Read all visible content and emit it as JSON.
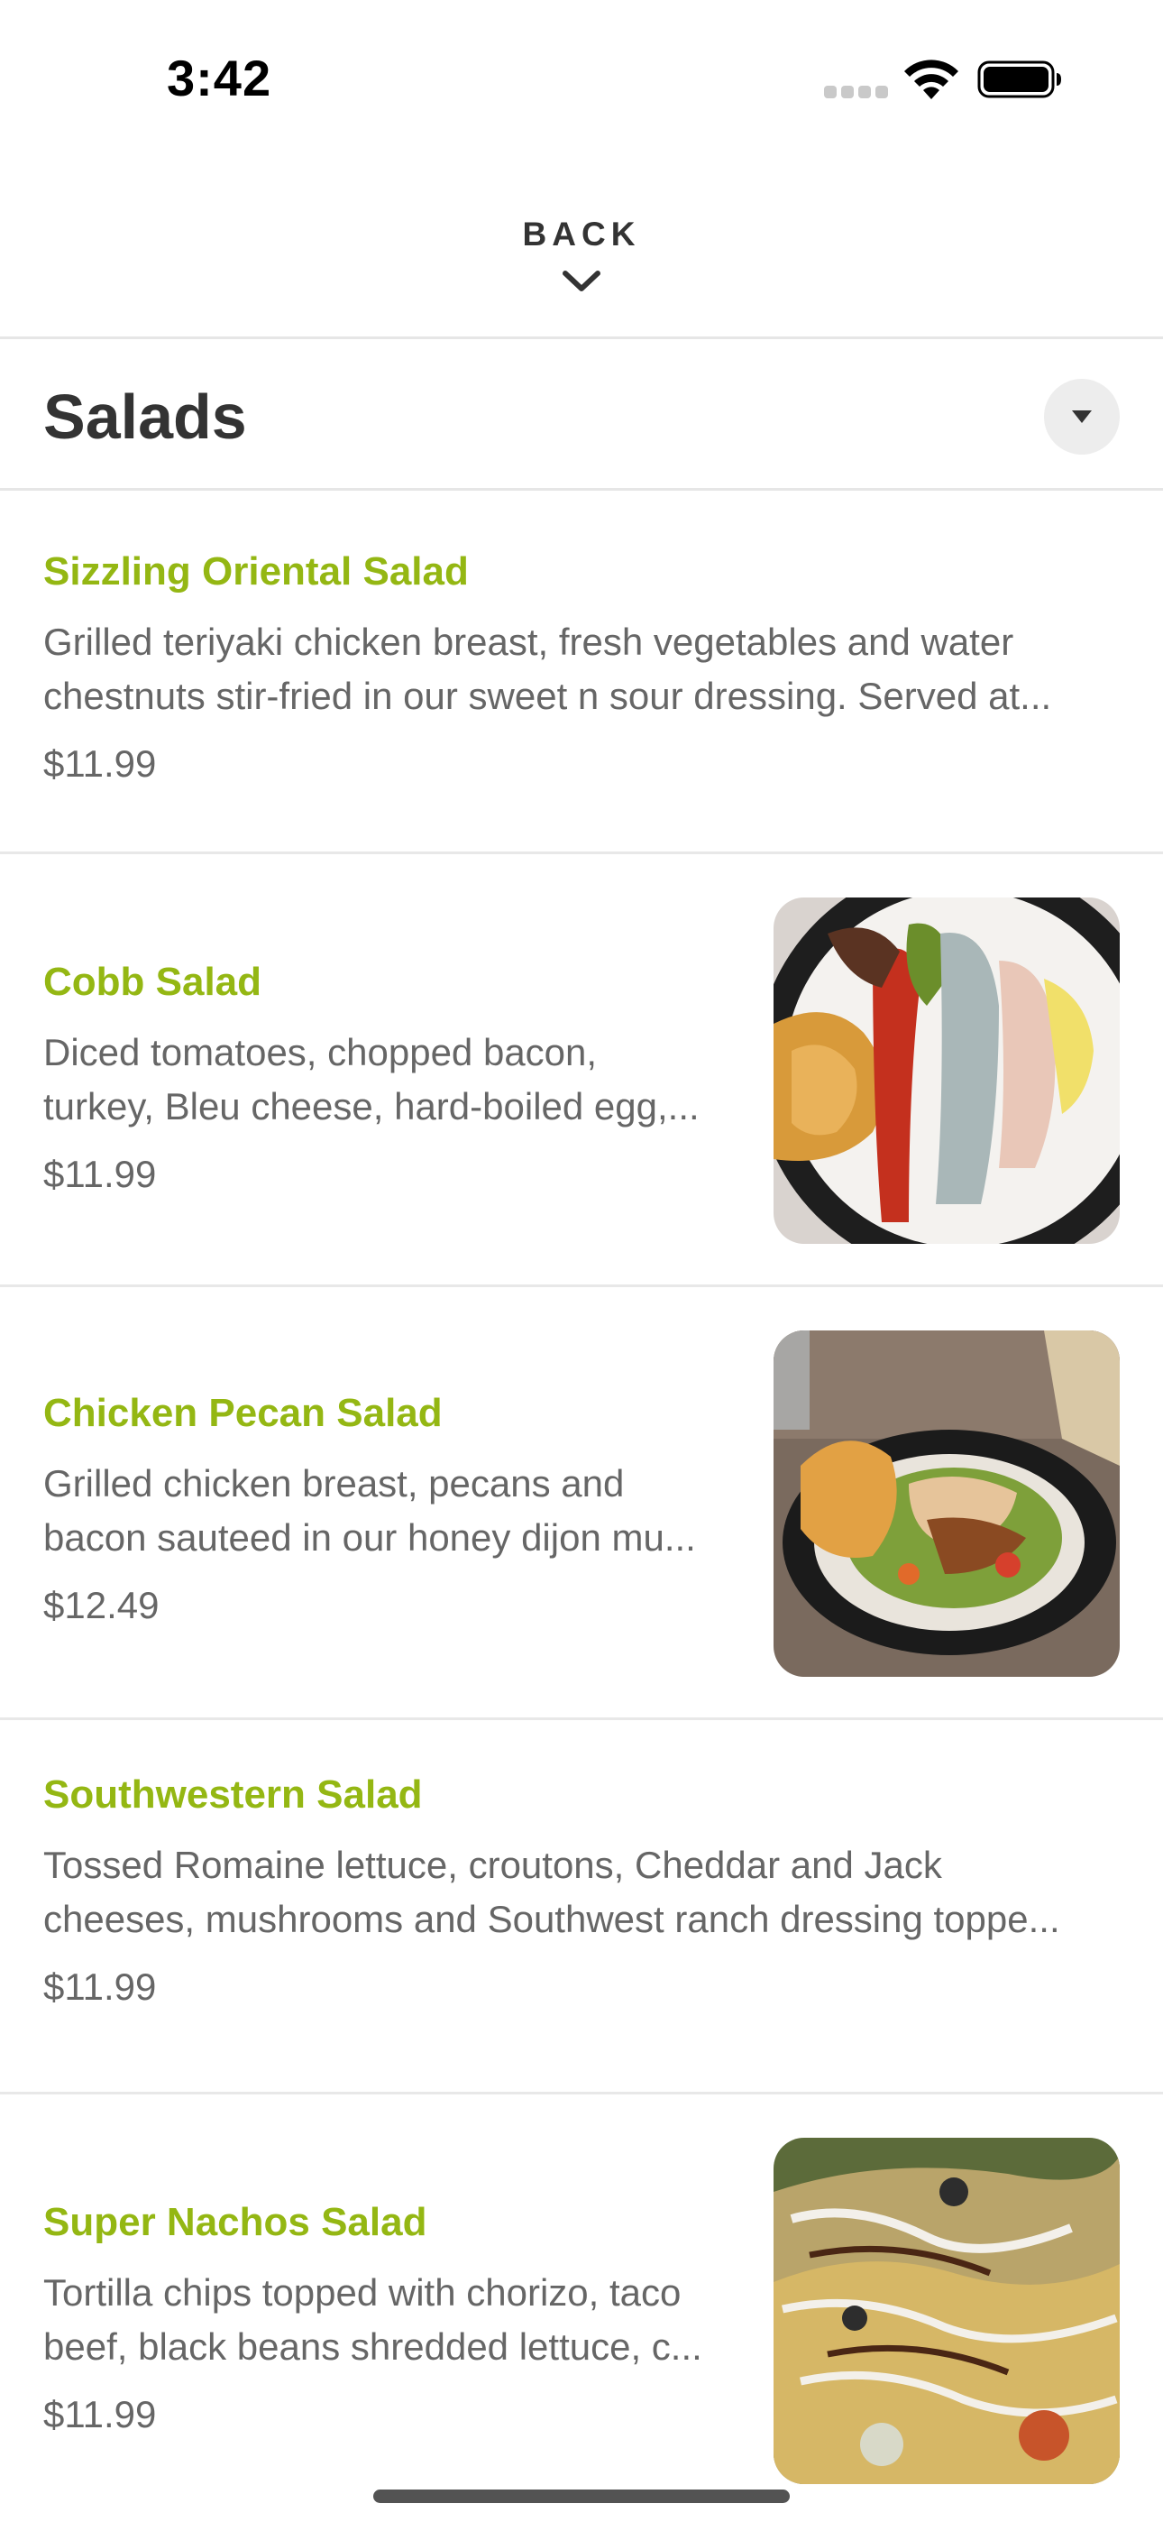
{
  "status_bar": {
    "time": "3:42"
  },
  "header": {
    "back_label": "BACK"
  },
  "category": {
    "title": "Salads"
  },
  "items": [
    {
      "name": "Sizzling Oriental Salad",
      "description_lines": [
        "Grilled teriyaki chicken breast, fresh vegetables and water",
        "chestnuts stir-fried in our sweet n sour dressing. Served at..."
      ],
      "price": "$11.99",
      "has_photo": false
    },
    {
      "name": "Cobb Salad",
      "description_lines": [
        "Diced tomatoes, chopped bacon,",
        "turkey, Bleu cheese, hard-boiled egg,..."
      ],
      "price": "$11.99",
      "has_photo": true
    },
    {
      "name": "Chicken Pecan Salad",
      "description_lines": [
        "Grilled chicken breast, pecans and",
        "bacon sauteed in our honey dijon mu..."
      ],
      "price": "$12.49",
      "has_photo": true
    },
    {
      "name": "Southwestern Salad",
      "description_lines": [
        "Tossed Romaine lettuce, croutons, Cheddar and Jack",
        "cheeses, mushrooms and Southwest ranch dressing toppe..."
      ],
      "price": "$11.99",
      "has_photo": false
    },
    {
      "name": "Super Nachos Salad",
      "description_lines": [
        "Tortilla chips topped with chorizo, taco",
        "beef, black beans shredded lettuce, c..."
      ],
      "price": "$11.99",
      "has_photo": true
    }
  ],
  "icons": {
    "wifi": "wifi-icon",
    "battery": "battery-icon",
    "signal": "cellular-signal-icon",
    "back": "chevron-down-icon",
    "category_toggle": "caret-down-icon"
  },
  "colors": {
    "accent": "#94b713",
    "text_primary": "#333333",
    "text_secondary": "#666666",
    "divider": "#e6e6e6"
  }
}
